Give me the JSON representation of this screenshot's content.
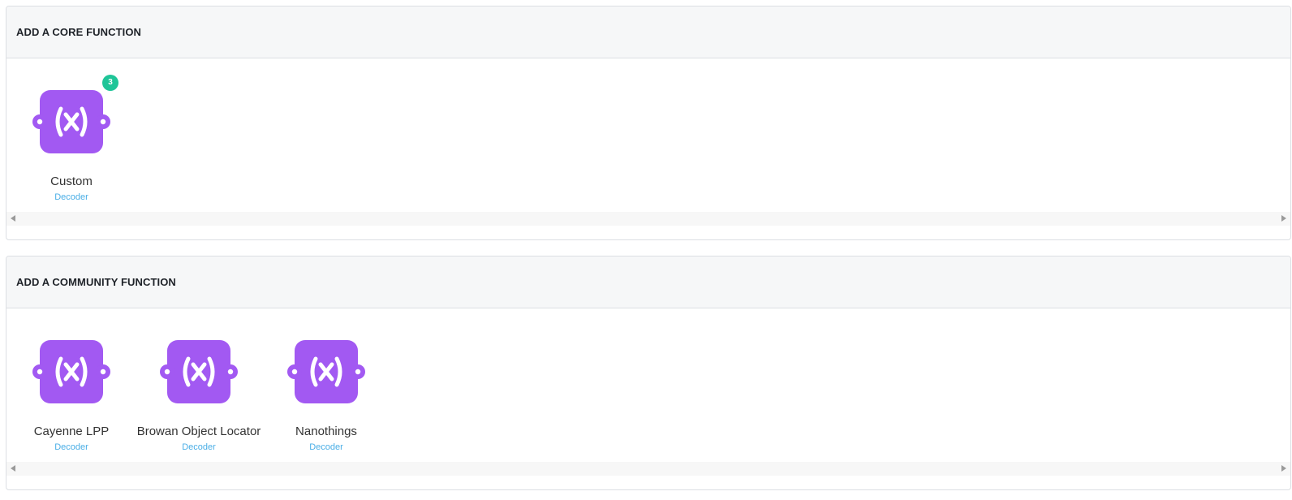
{
  "core": {
    "title": "ADD A CORE FUNCTION",
    "items": [
      {
        "name": "Custom",
        "type": "Decoder",
        "icon": "function-x-icon",
        "badge": "3"
      }
    ]
  },
  "community": {
    "title": "ADD A COMMUNITY FUNCTION",
    "items": [
      {
        "name": "Cayenne LPP",
        "type": "Decoder",
        "icon": "function-x-icon"
      },
      {
        "name": "Browan Object Locator",
        "type": "Decoder",
        "icon": "function-x-icon"
      },
      {
        "name": "Nanothings",
        "type": "Decoder",
        "icon": "function-x-icon"
      }
    ]
  },
  "colors": {
    "icon_bg": "#a259f2",
    "badge_bg": "#1fc598",
    "type_text": "#4aaee6",
    "header_bg": "#f6f7f8"
  }
}
